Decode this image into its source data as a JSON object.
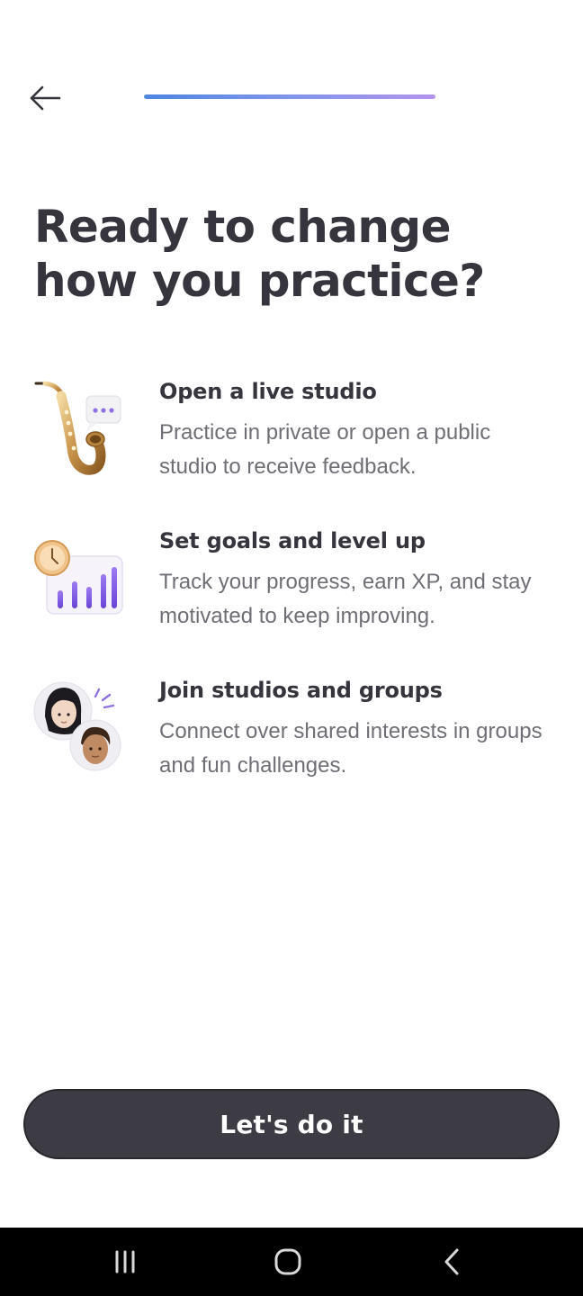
{
  "header": {
    "back_icon": "arrow-left-icon",
    "progress": 1.0,
    "progress_colors": [
      "#4d86e2",
      "#b393ef"
    ]
  },
  "title": "Ready to change how you practice?",
  "features": [
    {
      "icon": "saxophone-icon",
      "title": "Open a live studio",
      "description": "Practice in private or open a public studio to receive feedback."
    },
    {
      "icon": "progress-chart-icon",
      "title": "Set goals and level up",
      "description": "Track your progress, earn XP, and stay motivated to keep improving."
    },
    {
      "icon": "people-group-icon",
      "title": "Join studios and groups",
      "description": "Connect over shared interests in groups and fun challenges."
    }
  ],
  "cta": {
    "label": "Let's do it",
    "color": "#3d3c44"
  },
  "system_nav": {
    "recents_icon": "recents-icon",
    "home_icon": "home-icon",
    "back_icon": "system-back-icon"
  }
}
